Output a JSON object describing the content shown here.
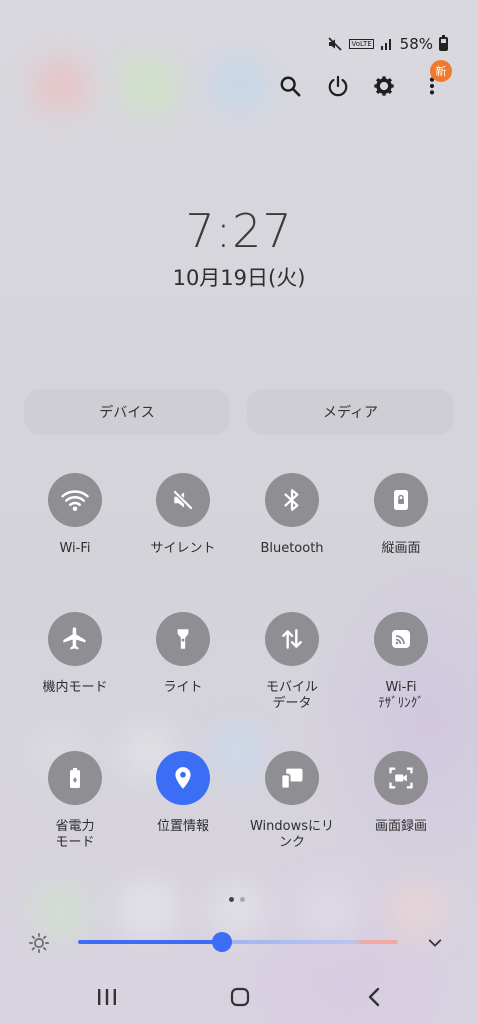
{
  "status_bar": {
    "signal_label": "VoLTE",
    "battery": "58%"
  },
  "clock": {
    "time": "7:27",
    "date": "10月19日(火)"
  },
  "badge": "新",
  "segments": {
    "device_label": "デバイス",
    "media_label": "メディア"
  },
  "tiles": [
    {
      "label": "Wi-Fi",
      "icon": "wifi-icon",
      "active": false
    },
    {
      "label": "サイレント",
      "icon": "mute-icon",
      "active": false
    },
    {
      "label": "Bluetooth",
      "icon": "bluetooth-icon",
      "active": false
    },
    {
      "label": "縦画面",
      "icon": "portrait-lock-icon",
      "active": false
    },
    {
      "label": "機内モード",
      "icon": "airplane-icon",
      "active": false
    },
    {
      "label": "ライト",
      "icon": "flashlight-icon",
      "active": false
    },
    {
      "label": "モバイル\nデータ",
      "icon": "mobile-data-icon",
      "active": false
    },
    {
      "label": "Wi-Fi\nﾃｻﾞﾘﾝｸﾞ",
      "icon": "hotspot-icon",
      "active": false
    },
    {
      "label": "省電力\nモード",
      "icon": "power-saving-icon",
      "active": false
    },
    {
      "label": "位置情報",
      "icon": "location-icon",
      "active": true
    },
    {
      "label": "Windowsにリ\nンク",
      "icon": "link-to-windows-icon",
      "active": false
    },
    {
      "label": "画面録画",
      "icon": "screen-recorder-icon",
      "active": false
    }
  ],
  "pages": {
    "current": 1,
    "total": 2
  },
  "brightness": {
    "level": 0.45
  },
  "colors": {
    "accent": "#3b6ef5",
    "tile_off": "#8f8f93",
    "badge": "#f07a2c"
  }
}
